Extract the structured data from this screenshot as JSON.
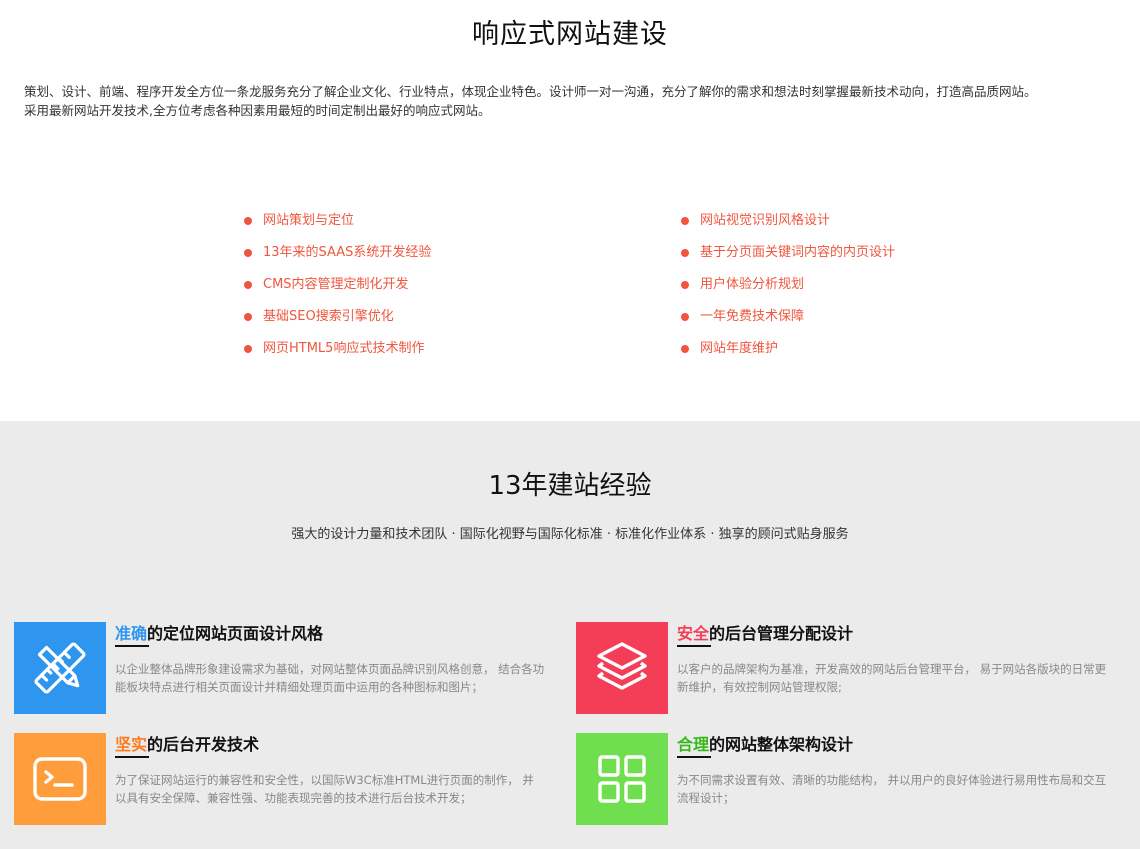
{
  "header": {
    "title": "响应式网站建设",
    "intro_line1": "策划、设计、前端、程序开发全方位一条龙服务充分了解企业文化、行业特点，体现企业特色。设计师一对一沟通，充分了解你的需求和想法时刻掌握最新技术动向，打造高品质网站。",
    "intro_line2": "采用最新网站开发技术,全方位考虑各种因素用最短的时间定制出最好的响应式网站。"
  },
  "features": {
    "accent_color": "#f0563e",
    "left": [
      "网站策划与定位",
      "13年来的SAAS系统开发经验",
      "CMS内容管理定制化开发",
      "基础SEO搜索引擎优化",
      "网页HTML5响应式技术制作"
    ],
    "right": [
      "网站视觉识别风格设计",
      "基于分页面关键词内容的内页设计",
      "用户体验分析规划",
      "一年免费技术保障",
      "网站年度维护"
    ]
  },
  "experience": {
    "title": "13年建站经验",
    "subtitle": "强大的设计力量和技术团队 · 国际化视野与国际化标准 · 标准化作业体系 · 独享的顾问式贴身服务",
    "cards": [
      {
        "highlight": "准确",
        "rest": "的定位网站页面设计风格",
        "desc": "以企业整体品牌形象建设需求为基础，对网站整体页面品牌识别风格创意， 结合各功能板块特点进行相关页面设计并精细处理页面中运用的各种图标和图片；",
        "color": "#2f96f0",
        "icon": "ruler-pencil-icon"
      },
      {
        "highlight": "安全",
        "rest": "的后台管理分配设计",
        "desc": "以客户的品牌架构为基准，开发高效的网站后台管理平台， 易于网站各版块的日常更新维护，有效控制网站管理权限;",
        "color": "#f43e58",
        "icon": "layers-icon"
      },
      {
        "highlight": "坚实",
        "rest": "的后台开发技术",
        "desc": "为了保证网站运行的兼容性和安全性，以国际W3C标准HTML进行页面的制作， 并以具有安全保障、兼容性强、功能表现完善的技术进行后台技术开发；",
        "color": "#ff9d3c",
        "icon": "terminal-icon"
      },
      {
        "highlight": "合理",
        "rest": "的网站整体架构设计",
        "desc": "为不同需求设置有效、清晰的功能结构， 并以用户的良好体验进行易用性布局和交互流程设计；",
        "color": "#6fdf50",
        "icon": "grid-icon"
      }
    ]
  }
}
